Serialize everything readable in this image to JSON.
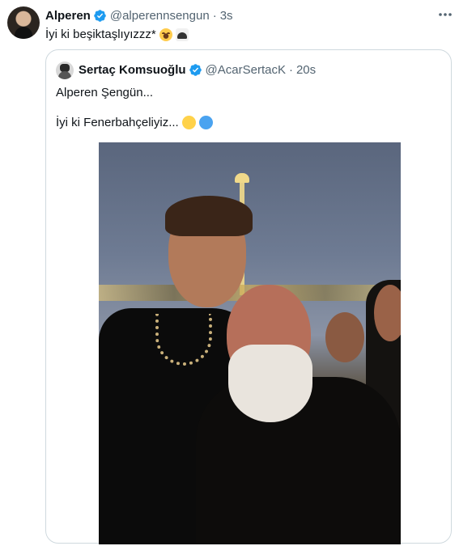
{
  "tweet": {
    "author_name": "Alperen",
    "author_handle": "@alperennsengun",
    "separator": "·",
    "time": "3s",
    "text": "İyi ki beşiktaşlıyızzz*",
    "emojis": [
      "grinning-sweat-emoji",
      "eagle-emoji"
    ]
  },
  "quoted_tweet": {
    "author_name": "Sertaç Komsuoğlu",
    "author_handle": "@AcarSertacK",
    "separator": "·",
    "time": "20s",
    "line1": "Alperen Şengün...",
    "line2": "İyi ki Fenerbahçeliyiz...",
    "emojis": [
      "yellow-circle-emoji",
      "blue-circle-emoji"
    ]
  },
  "colors": {
    "verified": "#1d9bf0",
    "secondary_text": "#536471",
    "border": "#cfd9de"
  }
}
